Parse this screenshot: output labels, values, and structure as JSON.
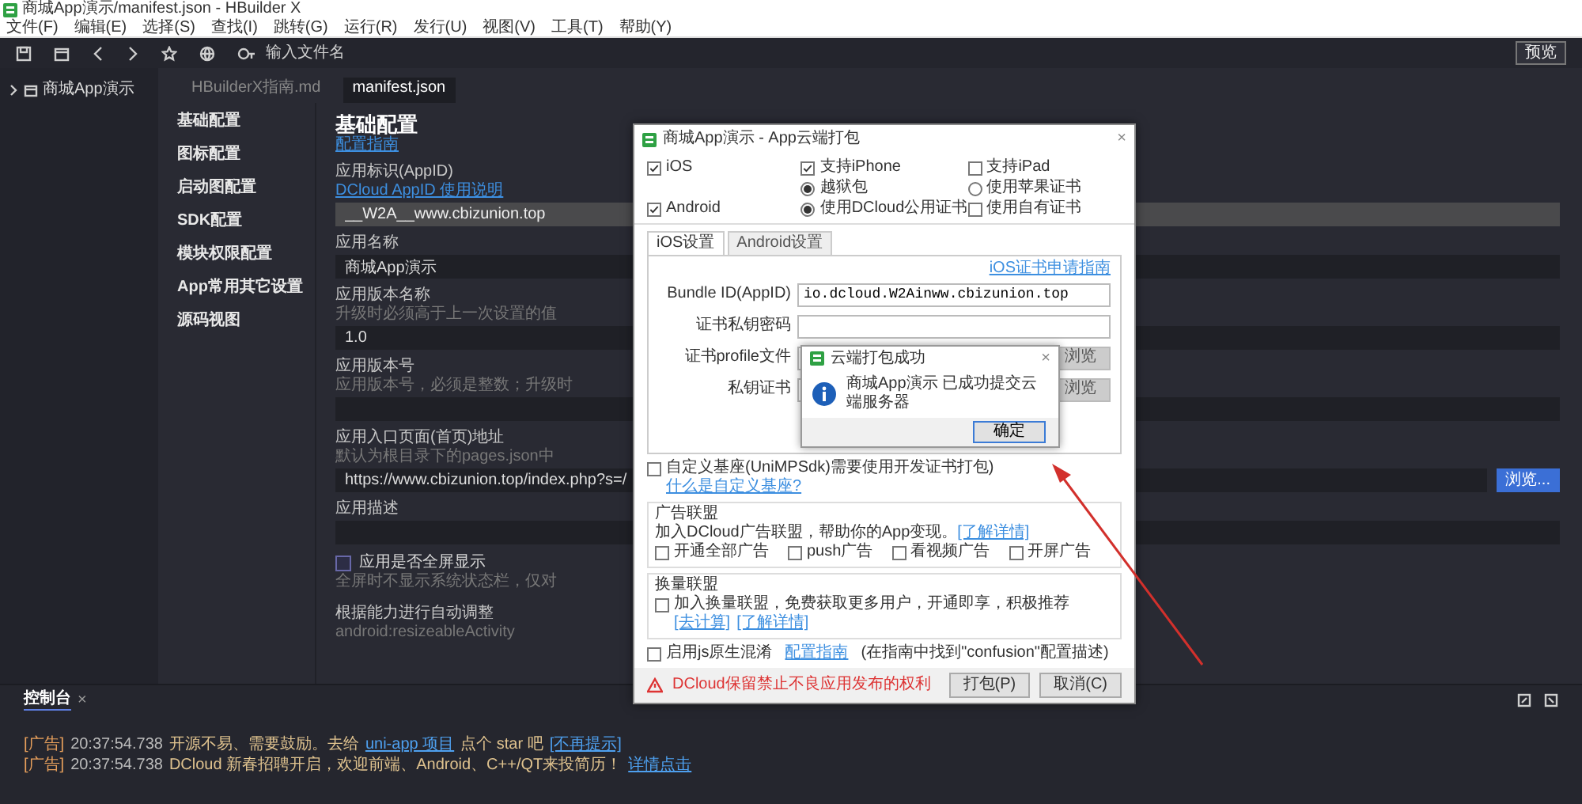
{
  "window": {
    "title": "商城App演示/manifest.json - HBuilder X"
  },
  "menu": [
    "文件(F)",
    "编辑(E)",
    "选择(S)",
    "查找(I)",
    "跳转(G)",
    "运行(R)",
    "发行(U)",
    "视图(V)",
    "工具(T)",
    "帮助(Y)"
  ],
  "toolbar": {
    "placeholder": "输入文件名",
    "preview_button": "预览"
  },
  "project_tree": [
    {
      "label": "商城App演示",
      "expanded": false
    }
  ],
  "editor_tabs": [
    {
      "label": "HBuilderX指南.md",
      "selected": false
    },
    {
      "label": "manifest.json",
      "selected": true
    }
  ],
  "config_nav": [
    "基础配置",
    "图标配置",
    "启动图配置",
    "SDK配置",
    "模块权限配置",
    "App常用其它设置",
    "源码视图"
  ],
  "form": {
    "title": "基础配置",
    "guide_link": "配置指南",
    "fields": [
      {
        "kind": "text",
        "label": "应用标识(AppID)",
        "link": "DCloud AppID 使用说明",
        "value": "__W2A__www.cbizunion.top",
        "disabled": true
      },
      {
        "kind": "text",
        "label": "应用名称",
        "value": "商城App演示",
        "disabled": false
      },
      {
        "kind": "text",
        "label": "应用版本名称",
        "hint": "升级时必须高于上一次设置的值",
        "value": "1.0",
        "disabled": false
      },
      {
        "kind": "text",
        "label": "应用版本号",
        "hint": "应用版本号，必须是整数；升级时",
        "disabled": false
      },
      {
        "kind": "text",
        "label": "应用入口页面(首页)地址",
        "hint": "默认为根目录下的pages.json中",
        "value": "https://www.cbizunion.top/index.php?s=/",
        "button": "浏览...",
        "disabled": false
      },
      {
        "kind": "text",
        "label": "应用描述",
        "disabled": false
      },
      {
        "kind": "checkbox",
        "label": "应用是否全屏显示",
        "hint": "全屏时不显示系统状态栏，仅对",
        "checked": false
      },
      {
        "kind": "note",
        "label": "根据能力进行自动调整",
        "hint": "android:resizeableActivity"
      }
    ]
  },
  "dialog": {
    "title": "商城App演示 - App云端打包",
    "option_columns": [
      {
        "items": [
          {
            "kind": "checkbox",
            "label": "iOS",
            "checked": true
          },
          {
            "kind": "checkbox",
            "label": "Android",
            "checked": true
          }
        ]
      },
      {
        "items": [
          {
            "kind": "checkbox",
            "label": "支持iPhone",
            "checked": true
          },
          {
            "kind": "radio",
            "label": "越狱包",
            "selected": true
          },
          {
            "kind": "radio",
            "label": "使用DCloud公用证书",
            "selected": true
          }
        ]
      },
      {
        "items": [
          {
            "kind": "checkbox",
            "label": "支持iPad",
            "checked": false
          },
          {
            "kind": "radio",
            "label": "使用苹果证书",
            "selected": false
          },
          {
            "kind": "checkbox",
            "label": "使用自有证书",
            "checked": false
          }
        ]
      }
    ],
    "tabs": [
      {
        "label": "iOS设置",
        "selected": true
      },
      {
        "label": "Android设置",
        "selected": false
      }
    ],
    "guide_link": "iOS证书申请指南",
    "fields": [
      {
        "label": "Bundle ID(AppID)",
        "value": "io.dcloud.W2Ainww.cbizunion.top"
      },
      {
        "label": "证书私钥密码"
      },
      {
        "label": "证书profile文件",
        "button": "浏览"
      },
      {
        "label": "私钥证书",
        "button": "浏览"
      }
    ],
    "custom_base": {
      "label": "自定义基座(UniMPSdk)需要使用开发证书打包)",
      "link": "什么是自定义基座?",
      "checked": false
    },
    "ad_group": {
      "title": "广告联盟",
      "text": "加入DCloud广告联盟，帮助你的App变现。",
      "link": "[了解详情]",
      "options": [
        {
          "label": "开通全部广告",
          "checked": false
        },
        {
          "label": "push广告",
          "checked": false
        },
        {
          "label": "看视频广告",
          "checked": false
        },
        {
          "label": "开屏广告",
          "checked": false
        }
      ]
    },
    "exchange_group": {
      "title": "换量联盟",
      "label": "加入换量联盟，免费获取更多用户，开通即享，积极推荐",
      "checked": false,
      "links": [
        "[去计算]",
        "[了解详情]"
      ]
    },
    "obfuscation": {
      "label": "启用js原生混淆",
      "checked": false,
      "link": "配置指南",
      "note": "(在指南中找到\"confusion\"配置描述)"
    },
    "warning": "DCloud保留禁止不良应用发布的权利",
    "buttons": [
      "打包(P)",
      "取消(C)"
    ]
  },
  "success_dialog": {
    "title": "云端打包成功",
    "message": "商城App演示 已成功提交云端服务器",
    "button": "确定"
  },
  "console": {
    "tab": "控制台",
    "close": "×",
    "lines": [
      {
        "tag": "[广告]",
        "time": "20:37:54.738",
        "parts": [
          {
            "kind": "text",
            "text": "开源不易、需要鼓励。去给"
          },
          {
            "kind": "link",
            "text": "uni-app 项目"
          },
          {
            "kind": "text",
            "text": "点个 star 吧"
          },
          {
            "kind": "link",
            "text": "[不再提示]"
          }
        ]
      },
      {
        "tag": "[广告]",
        "time": "20:37:54.738",
        "parts": [
          {
            "kind": "text",
            "text": "DCloud 新春招聘开启，欢迎前端、Android、C++/QT来投简历！"
          },
          {
            "kind": "link",
            "text": "详情点击"
          }
        ]
      }
    ]
  }
}
